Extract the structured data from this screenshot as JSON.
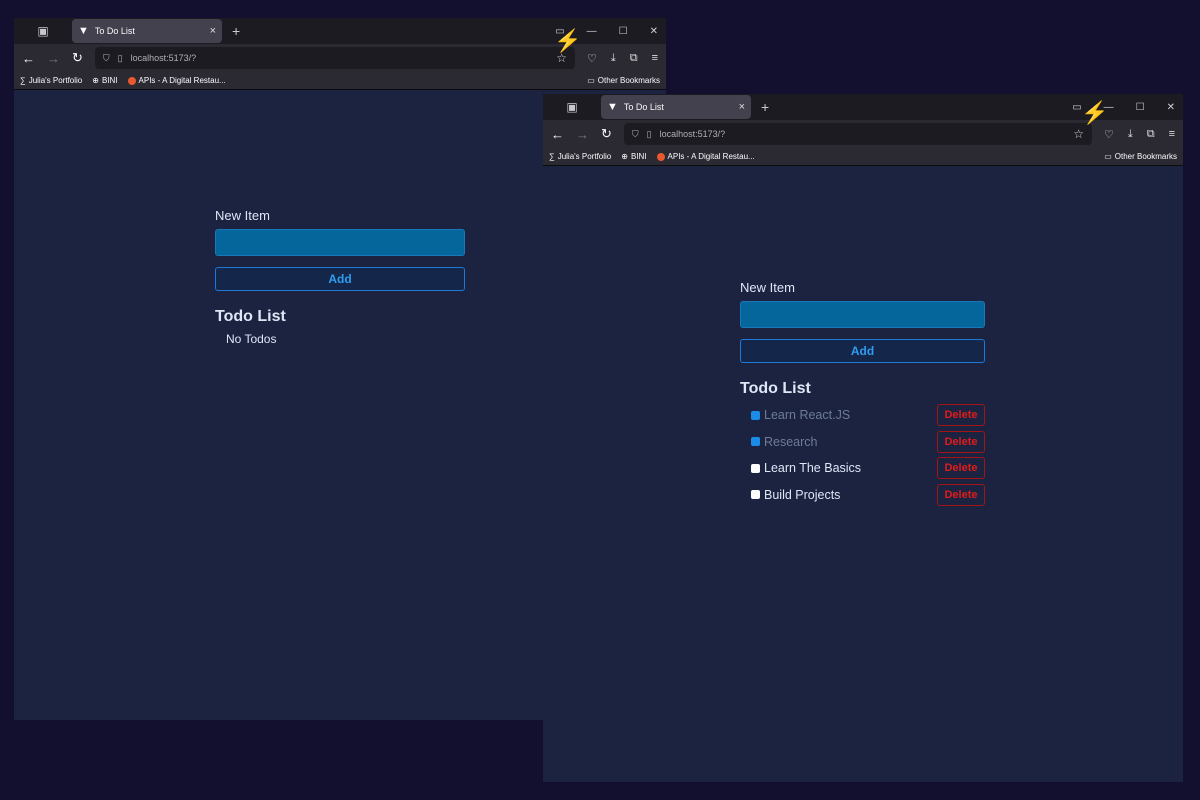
{
  "browser": {
    "tab_title": "To Do List",
    "url": "localhost:5173/?",
    "bookmarks": [
      "Julia's Portfolio",
      "BINI",
      "APIs - A Digital Restau..."
    ],
    "other_bookmarks": "Other Bookmarks"
  },
  "app": {
    "new_item_label": "New Item",
    "add_label": "Add",
    "list_title": "Todo List",
    "empty_text": "No Todos",
    "delete_label": "Delete"
  },
  "todos": [
    {
      "title": "Learn React.JS",
      "completed": true
    },
    {
      "title": "Research",
      "completed": true
    },
    {
      "title": "Learn The Basics",
      "completed": false
    },
    {
      "title": "Build Projects",
      "completed": false
    }
  ],
  "colors": {
    "page_bg": "#1b2341",
    "input": "#04669b",
    "accent": "#2f9df0",
    "danger": "#e01b1b"
  }
}
